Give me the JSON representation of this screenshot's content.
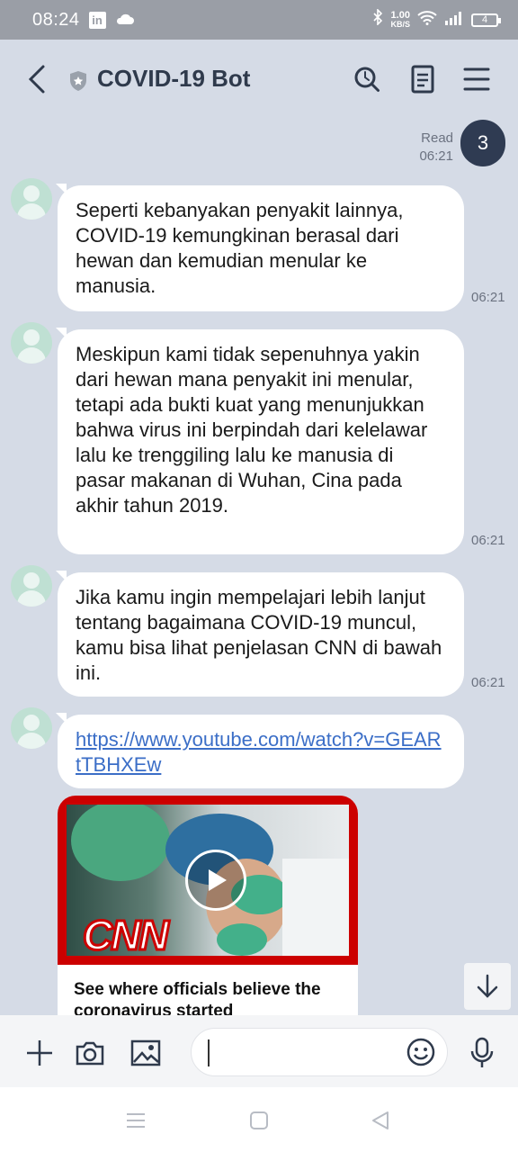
{
  "status": {
    "time": "08:24",
    "app_icon_text": "in",
    "speed_value": "1.00",
    "speed_unit": "KB/S",
    "battery": "4",
    "icons": [
      "linkedin-icon",
      "cloud-icon",
      "bluetooth-icon",
      "wifi-icon",
      "signal-icon",
      "battery-icon"
    ]
  },
  "header": {
    "title": "COVID-19 Bot",
    "icons": [
      "back-arrow-icon",
      "shield-icon",
      "search-icon",
      "notes-icon",
      "menu-icon"
    ]
  },
  "sent": {
    "read_label": "Read",
    "time": "06:21",
    "unread_count": "3"
  },
  "messages": [
    {
      "text": "Seperti kebanyakan penyakit lainnya, COVID-19 kemungkinan berasal dari hewan dan kemudian menular ke manusia.",
      "time": "06:21"
    },
    {
      "text": "Meskipun kami tidak sepenuhnya yakin dari hewan mana penyakit ini menular, tetapi ada bukti kuat yang menunjukkan bahwa virus ini berpindah dari kelelawar lalu ke trenggiling lalu ke manusia di pasar makanan di Wuhan, Cina pada akhir tahun 2019.",
      "time": "06:21"
    },
    {
      "text": "Jika kamu ingin mempelajari lebih lanjut tentang bagaimana COVID-19 muncul, kamu bisa lihat penjelasan CNN di bawah ini.",
      "time": "06:21"
    },
    {
      "link": "https://www.youtube.com/watch?v=GEARtTBHXEw"
    }
  ],
  "video": {
    "logo": "CNN",
    "title": "See where officials believe the coronavirus started"
  },
  "colors": {
    "background": "#d5dbe6",
    "accent": "#2f3b52",
    "link": "#3b6ec7",
    "cnn_red": "#cc0000"
  }
}
